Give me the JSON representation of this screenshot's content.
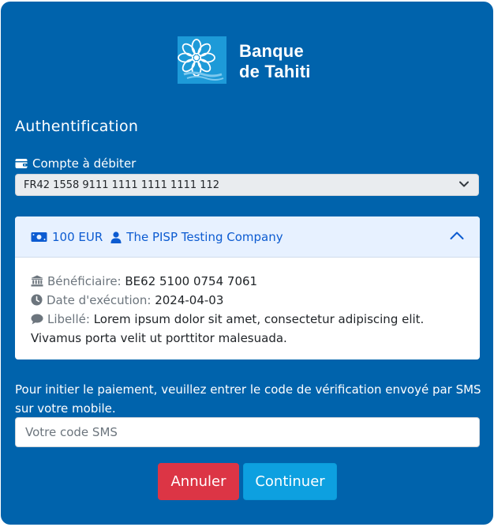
{
  "brand": {
    "name_line1": "Banque",
    "name_line2": "de Tahiti",
    "logo_color": "#1d9ad8",
    "panel_color": "#0063ac"
  },
  "page": {
    "title": "Authentification"
  },
  "account": {
    "label": "Compte à débiter",
    "icon": "wallet-icon",
    "selected": "FR42 1558 9111 1111 1111 1111 112"
  },
  "payment": {
    "amount": "100 EUR",
    "creditor": "The PISP Testing Company",
    "amount_icon": "money-bill-icon",
    "creditor_icon": "user-icon",
    "expanded": true,
    "details": {
      "beneficiary_label": "Bénéficiaire:",
      "beneficiary_value": "BE62 5100 0754 7061",
      "date_label": "Date d'exécution:",
      "date_value": "2024-04-03",
      "memo_label": "Libellé:",
      "memo_value": "Lorem ipsum dolor sit amet, consectetur adipiscing elit. Vivamus porta velit ut porttitor malesuada."
    }
  },
  "sms": {
    "instructions": "Pour initier le paiement, veuillez entrer le code de vérification envoyé par SMS sur votre mobile.",
    "placeholder": "Votre code SMS",
    "value": ""
  },
  "actions": {
    "cancel_label": "Annuler",
    "continue_label": "Continuer",
    "cancel_color": "#dc3545",
    "continue_color": "#0da0e0"
  }
}
